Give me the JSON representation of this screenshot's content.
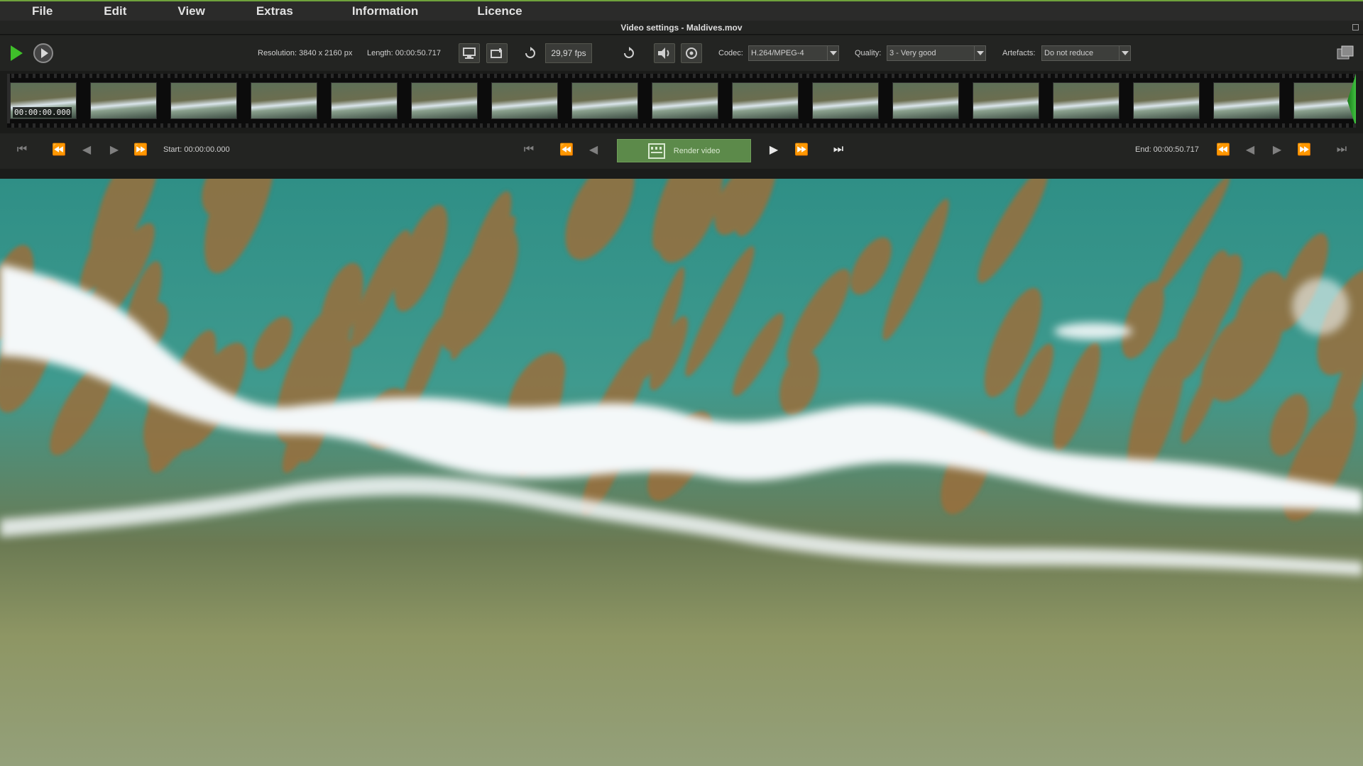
{
  "menu": [
    "File",
    "Edit",
    "View",
    "Extras",
    "Information",
    "Licence"
  ],
  "window_title": "Video settings - Maldives.mov",
  "toolbar": {
    "resolution": "Resolution: 3840 x 2160 px",
    "length": "Length: 00:00:50.717",
    "fps": "29,97 fps",
    "codec_label": "Codec:",
    "codec_value": "H.264/MPEG-4",
    "quality_label": "Quality:",
    "quality_value": "3 - Very good",
    "artefacts_label": "Artefacts:",
    "artefacts_value": "Do not reduce"
  },
  "filmstrip": {
    "first_frame_time": "00:00:00.000"
  },
  "transport": {
    "start": "Start: 00:00:00.000",
    "end": "End: 00:00:50.717",
    "render_label": "Render video"
  },
  "icons": [
    "play-icon",
    "preview-play-icon",
    "monitor-icon",
    "crop-icon",
    "loop-icon",
    "refresh-icon",
    "speaker-icon",
    "audio-settings-icon",
    "export-icon",
    "render-icon"
  ],
  "colors": {
    "accent_green": "#3fbf2a",
    "render_button": "#5c8a4a",
    "background": "#232422"
  }
}
